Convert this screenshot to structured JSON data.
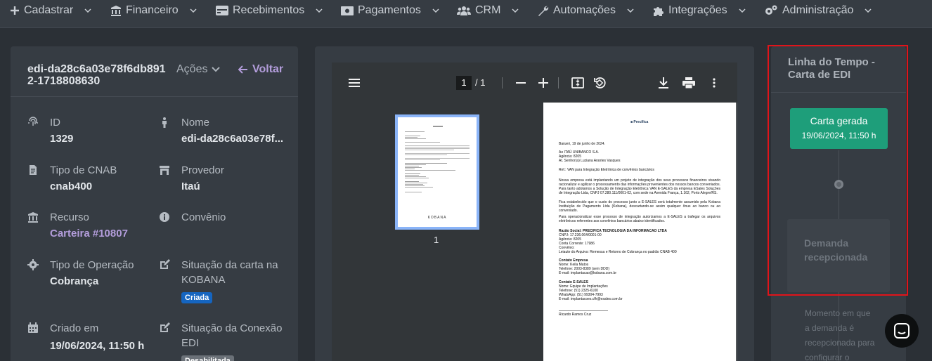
{
  "nav": [
    {
      "label": "Cadastrar",
      "icon": "plus-icon"
    },
    {
      "label": "Financeiro",
      "icon": "bank-icon"
    },
    {
      "label": "Recebimentos",
      "icon": "card-icon"
    },
    {
      "label": "Pagamentos",
      "icon": "money-icon"
    },
    {
      "label": "CRM",
      "icon": "users-icon"
    },
    {
      "label": "Automações",
      "icon": "wrench-icon"
    },
    {
      "label": "Integrações",
      "icon": "puzzle-icon"
    },
    {
      "label": "Administração",
      "icon": "gears-icon"
    }
  ],
  "detail": {
    "title": "edi-da28c6a03e78f6db8912-1718808630",
    "acoes_label": "Ações",
    "voltar_label": "Voltar",
    "fields": {
      "id": {
        "label": "ID",
        "value": "1329",
        "icon": "fingerprint-icon"
      },
      "nome": {
        "label": "Nome",
        "value": "edi-da28c6a03e78f...",
        "icon": "person-icon"
      },
      "tipo_cnab": {
        "label": "Tipo de CNAB",
        "value": "cnab400",
        "icon": "file-icon"
      },
      "provedor": {
        "label": "Provedor",
        "value": "Itaú",
        "icon": "storefront-icon"
      },
      "recurso": {
        "label": "Recurso",
        "value": "Carteira #10807",
        "icon": "bank-icon"
      },
      "convenio": {
        "label": "Convênio",
        "value": "",
        "icon": "info-icon"
      },
      "tipo_operacao": {
        "label": "Tipo de Operação",
        "value": "Cobrança",
        "icon": "cog-icon"
      },
      "situacao_carta": {
        "label": "Situação da carta na KOBANA",
        "badge": "Criada",
        "badge_color": "#1565c0",
        "icon": "edit-icon"
      },
      "criado_em": {
        "label": "Criado em",
        "value": "19/06/2024, 11:50 h",
        "icon": "calendar-icon"
      },
      "situacao_conexao": {
        "label": "Situação da Conexão EDI",
        "badge": "Desabilitada",
        "badge_color": "#6b7178",
        "icon": "edit-icon"
      }
    }
  },
  "viewer": {
    "page_current": "1",
    "page_total": "/ 1",
    "thumb_label": "1",
    "thumb_logo": "KOBANA",
    "doc": {
      "logo": "Precifica",
      "date_line": "Barueri, 19 de junho de 2024.",
      "address": [
        "Ao ITAÚ UNIBANCO S.A.",
        "Agência: 8205",
        "At. Senhor(a) Luziana Arantes Vasques"
      ],
      "ref": "Ref.: VAN para Integração Eletrônica de convênios bancários",
      "p1": "Nossa empresa está implantando um projeto de integração dos seus processos financeiros visando racionalizar e agilizar o processamento das informações provenientes dos nossos bancos conveniados. Para tanto adotamos a Solução de Integração Eletrônica VAN E-SALES da empresa ESales Soluções de Integração Ltda, CNPJ 07.280.111/0001-02, com sede na Avenida França, 1.162, Porto Alegre/RS.",
      "p2": "Fica estabelecido que o custo do processo junto a E-SALES será totalmente assumido pela Kobana Instituição de Pagamento Ltda (Kobana), descartando-se assim qualquer ônus ao banco ou ao conveniado.",
      "p3": "Para operacionalizar esse processo de integração autorizamos a E-SALES a trafegar os arquivos eletrônicos referentes aos convênios bancários abaixo identificados.",
      "company": [
        "Razão Social: PRECIFICA TECNOLOGIA DA INFORMACAO LTDA",
        "CNPJ: 17.236.064/0001-00",
        "Agência: 8205",
        "Conta Corrente: 17986",
        "Convênio:",
        "Leiaute do Arquivo: Remessa e Retorno de Cobrança no padrão CNAB 400"
      ],
      "contato_empresa": [
        "Contato Empresa",
        "Nome: Keila Matos",
        "Telefone: 2003-8389 (sem DDD)",
        "E-mail: implantacao@kobana.com.br"
      ],
      "contato_esales": [
        "Contato E-SALES",
        "Nome: Equipe de Implantações",
        "Telefone: (51) 2325-6100",
        "WhatsApp: (51) 99304-7993",
        "E-mail: implantacoes.cfh@esales.com.br"
      ],
      "signature": "Ricardo Ramos Cruz"
    }
  },
  "timeline": {
    "title": "Linha do Tempo - Carta de EDI",
    "step1_title": "Carta gerada",
    "step1_date": "19/06/2024, 11:50 h",
    "step2_title": "Demanda recepcionada",
    "step2_desc": "Momento em que a demanda é recepcionada para configurar o"
  },
  "colors": {
    "accent_purple": "#b39ddb",
    "success": "#1e9e7a",
    "highlight": "#e0141a"
  }
}
